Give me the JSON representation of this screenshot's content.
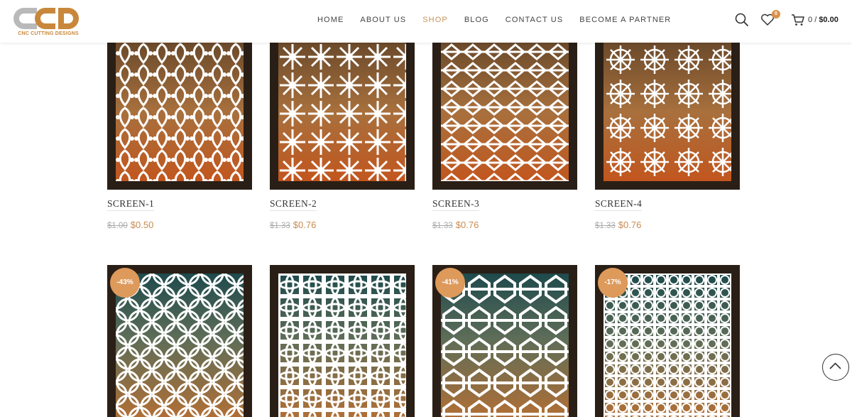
{
  "brand": {
    "logo_text": "CNC CUTTING DESIGNS",
    "accent": "#c8935a",
    "logo_color": "#c8873a"
  },
  "nav": {
    "items": [
      "HOME",
      "ABOUT US",
      "SHOP",
      "BLOG",
      "CONTACT US",
      "BECOME A PARTNER"
    ],
    "active": "SHOP"
  },
  "header_icons": {
    "search": "search-icon",
    "wishlist": "heart-icon",
    "wishlist_count": "0",
    "cart": "cart-icon",
    "cart_count": "0",
    "cart_separator": "/",
    "cart_total": "$0.00"
  },
  "products": [
    {
      "name": "SCREEN-1",
      "old_price": "$1.00",
      "price": "$0.50",
      "sale_badge": ""
    },
    {
      "name": "SCREEN-2",
      "old_price": "$1.33",
      "price": "$0.76",
      "sale_badge": ""
    },
    {
      "name": "SCREEN-3",
      "old_price": "$1.33",
      "price": "$0.76",
      "sale_badge": ""
    },
    {
      "name": "SCREEN-4",
      "old_price": "$1.33",
      "price": "$0.76",
      "sale_badge": ""
    },
    {
      "name": "",
      "old_price": "",
      "price": "",
      "sale_badge": "-43%"
    },
    {
      "name": "",
      "old_price": "",
      "price": "",
      "sale_badge": ""
    },
    {
      "name": "",
      "old_price": "",
      "price": "",
      "sale_badge": "-41%"
    },
    {
      "name": "",
      "old_price": "",
      "price": "",
      "sale_badge": "-17%"
    }
  ],
  "scroll_top": "chevron-up-icon"
}
